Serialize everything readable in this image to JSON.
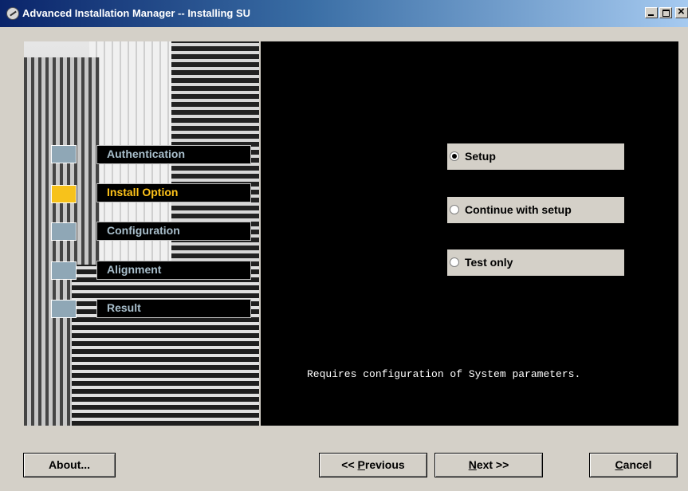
{
  "window": {
    "title": "Advanced Installation Manager -- Installing SU",
    "icon": "app-icon"
  },
  "steps": [
    {
      "label": "Authentication",
      "active": false
    },
    {
      "label": "Install Option",
      "active": true
    },
    {
      "label": "Configuration",
      "active": false
    },
    {
      "label": "Alignment",
      "active": false
    },
    {
      "label": "Result",
      "active": false
    }
  ],
  "options": [
    {
      "label": "Setup",
      "selected": true
    },
    {
      "label": "Continue with setup",
      "selected": false
    },
    {
      "label": "Test only",
      "selected": false
    }
  ],
  "description": "Requires configuration of System parameters.",
  "buttons": {
    "about": "About...",
    "previous_prefix": "<< ",
    "previous_underlined": "P",
    "previous_rest": "revious",
    "next_underlined": "N",
    "next_rest": "ext >>",
    "cancel_underlined": "C",
    "cancel_rest": "ancel"
  },
  "colors": {
    "active_step": "#f7c21b",
    "inactive_step": "#8fa7b6",
    "panel_bg": "#000000"
  }
}
